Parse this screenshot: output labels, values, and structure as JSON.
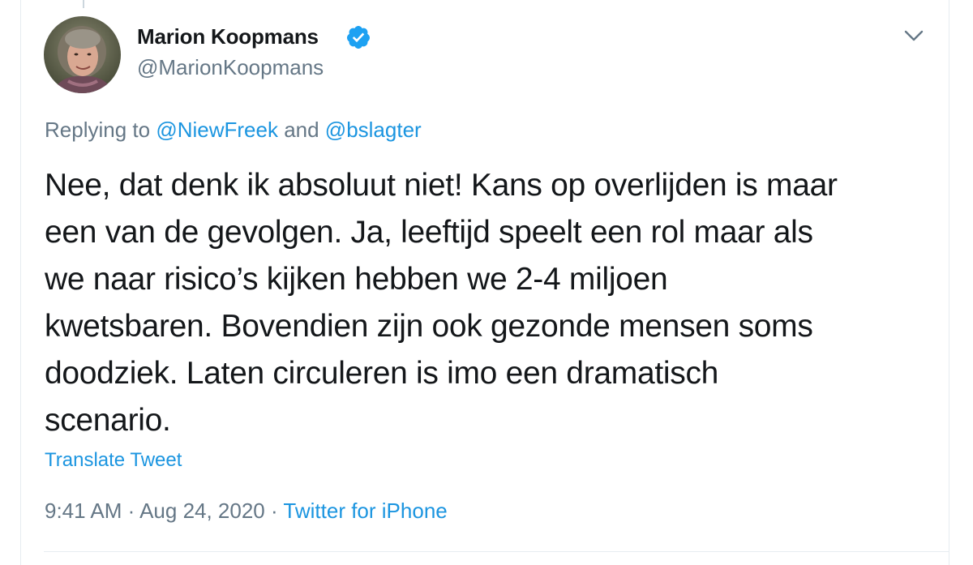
{
  "tweet": {
    "author_name": "Marion Koopmans",
    "author_handle": "@MarionKoopmans",
    "verified_icon": "verified-badge-icon",
    "replying_prefix": "Replying to ",
    "reply_mention_1": "@NiewFreek",
    "reply_and": " and ",
    "reply_mention_2": "@bslagter",
    "text_lines": [
      "Nee, dat denk ik absoluut niet! Kans op overlijden is maar",
      "een van de gevolgen. Ja, leeftijd speelt een rol maar als",
      "we naar risico’s kijken hebben we 2-4 miljoen",
      "kwetsbaren. Bovendien zijn ook gezonde mensen soms",
      "doodziek. Laten circuleren is imo een dramatisch",
      "scenario."
    ],
    "translate_label": "Translate Tweet",
    "time": "9:41 AM",
    "separator": " · ",
    "date": "Aug 24, 2020",
    "source": "Twitter for iPhone"
  },
  "colors": {
    "text": "#14171a",
    "secondary": "#657786",
    "link": "#1b95e0",
    "verified": "#1da1f2",
    "border": "#e6ecf0"
  },
  "icons": {
    "caret": "chevron-down-icon",
    "avatar": "avatar"
  }
}
